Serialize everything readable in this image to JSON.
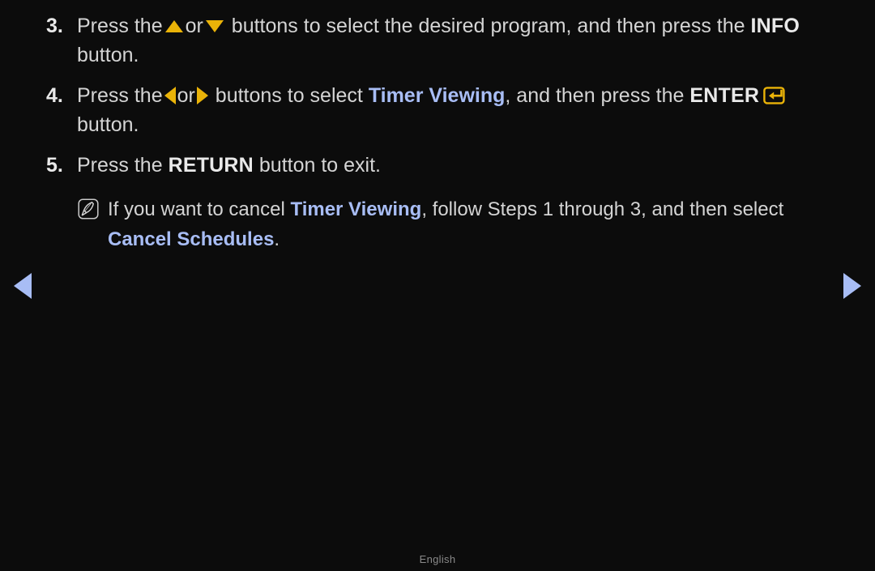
{
  "background_color": "#0c0c0c",
  "accent_colors": {
    "gold": "#eab308",
    "blue": "#a8bdf5",
    "body_text": "#d4d4d4",
    "bold_text": "#e9e9e9",
    "footer_text": "#8a8a8a"
  },
  "steps": [
    {
      "number": "3.",
      "parts": {
        "lead": "Press the",
        "icon_up": "triangle-up-icon",
        "or": "or",
        "icon_down": "triangle-down-icon",
        "middle": "buttons to select the desired program, and then press the",
        "key": "INFO",
        "tail": "button."
      }
    },
    {
      "number": "4.",
      "parts": {
        "lead": "Press the",
        "icon_left": "triangle-left-icon",
        "or": "or",
        "icon_right": "triangle-right-icon",
        "middle": "buttons to select",
        "highlight": "Timer Viewing",
        "middle2": ", and then press the",
        "key": "ENTER",
        "key_icon": "enter-key-icon",
        "tail": "button."
      }
    },
    {
      "number": "5.",
      "parts": {
        "lead": "Press the",
        "key": "RETURN",
        "tail": "button to exit."
      }
    }
  ],
  "note": {
    "icon": "note-pen-icon",
    "lead": "If you want to cancel",
    "highlight1": "Timer Viewing",
    "middle": ", follow Steps 1 through 3, and then select",
    "highlight2": "Cancel Schedules",
    "tail": "."
  },
  "navigation": {
    "prev_label": "previous-page",
    "next_label": "next-page"
  },
  "footer": {
    "language": "English"
  }
}
